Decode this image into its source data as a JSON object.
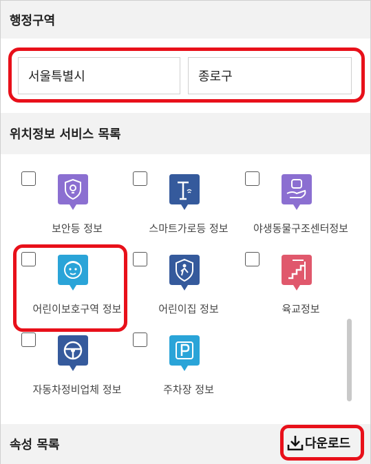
{
  "admin": {
    "title": "행정구역",
    "city": "서울특별시",
    "district": "종로구"
  },
  "location_services": {
    "title": "위치정보 서비스 목록",
    "items": [
      {
        "label": "보안등 정보",
        "icon": "security-light-icon",
        "color": "#8b6fd1",
        "checked": false
      },
      {
        "label": "스마트가로등 정보",
        "icon": "smart-streetlight-icon",
        "color": "#355a9c",
        "checked": false
      },
      {
        "label": "야생동물구조센터정보",
        "icon": "wildlife-rescue-icon",
        "color": "#8b6fd1",
        "checked": false
      },
      {
        "label": "어린이보호구역 정보",
        "icon": "child-face-icon",
        "color": "#2aa4d8",
        "checked": false
      },
      {
        "label": "어린이집 정보",
        "icon": "daycare-shield-icon",
        "color": "#355a9c",
        "checked": false
      },
      {
        "label": "육교정보",
        "icon": "overpass-stairs-icon",
        "color": "#e0586c",
        "checked": false
      },
      {
        "label": "자동차정비업체 정보",
        "icon": "steering-wheel-icon",
        "color": "#355a9c",
        "checked": false
      },
      {
        "label": "주차장 정보",
        "icon": "parking-icon",
        "color": "#2aa4d8",
        "checked": false
      }
    ]
  },
  "attributes": {
    "title": "속성 목록",
    "download_label": "다운로드"
  }
}
